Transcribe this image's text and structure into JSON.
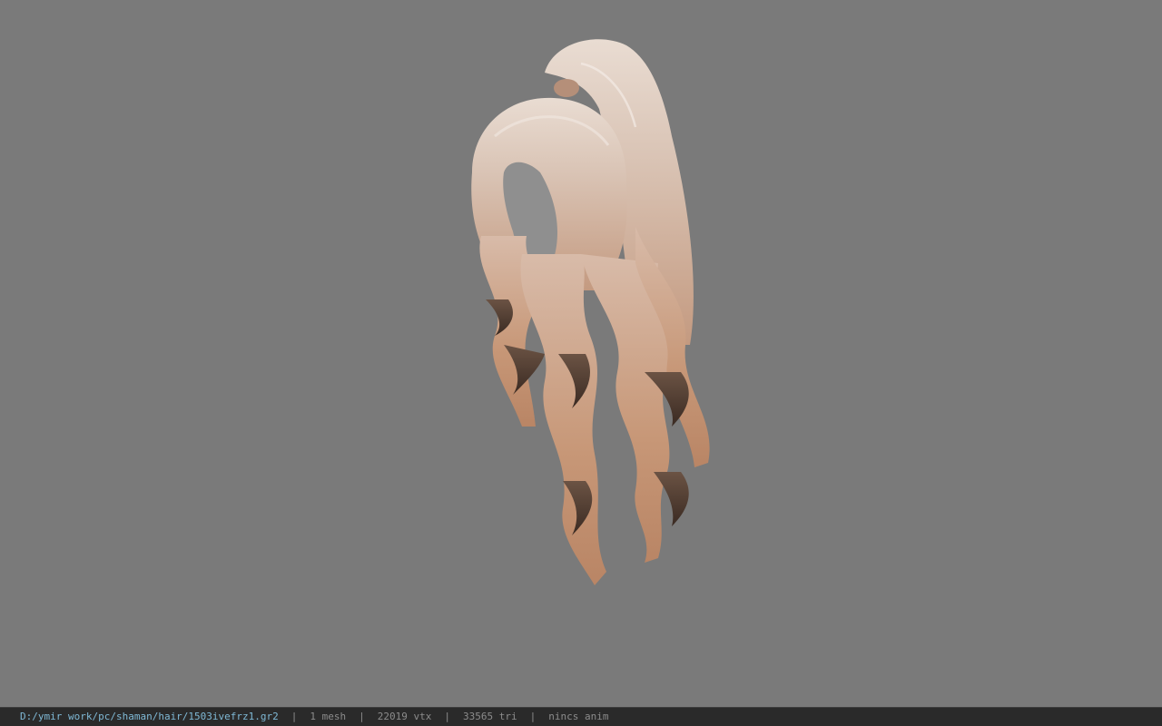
{
  "viewer": {
    "background_color": "#7a7a7a",
    "model_icon": "hair-model"
  },
  "status": {
    "file_path": "D:/ymir work/pc/shaman/hair/1503ivefrz1.gr2",
    "separator": "|",
    "mesh_count": "1 mesh",
    "vertex_count": "22019 vtx",
    "triangle_count": "33565 tri",
    "anim_info": "nincs anim",
    "path_color": "#7fb9d6"
  }
}
